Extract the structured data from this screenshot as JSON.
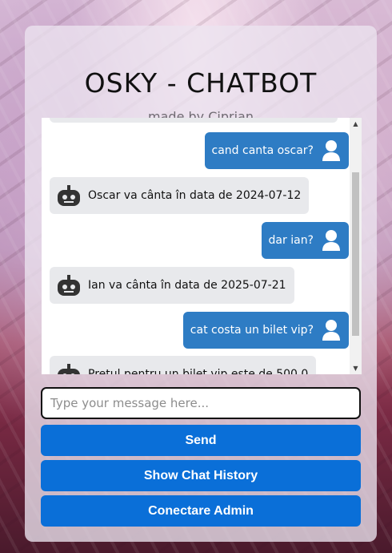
{
  "header": {
    "title": "OSKY - CHATBOT",
    "subtitle": "made by Ciprian"
  },
  "messages": [
    {
      "sender": "user",
      "text": "cand canta oscar?"
    },
    {
      "sender": "bot",
      "text": "Oscar va cânta în data de 2024-07-12"
    },
    {
      "sender": "user",
      "text": "dar ian?"
    },
    {
      "sender": "bot",
      "text": "Ian va cânta în data de 2025-07-21"
    },
    {
      "sender": "user",
      "text": "cat costa un bilet vip?"
    },
    {
      "sender": "bot",
      "text": "Pretul pentru un bilet vip este de 500.0"
    }
  ],
  "input": {
    "placeholder": "Type your message here...",
    "value": ""
  },
  "buttons": {
    "send": "Send",
    "history": "Show Chat History",
    "admin": "Conectare Admin"
  },
  "colors": {
    "user_bubble": "#2e7cc4",
    "bot_bubble": "#e8e9ec",
    "button": "#0a6fd8"
  }
}
